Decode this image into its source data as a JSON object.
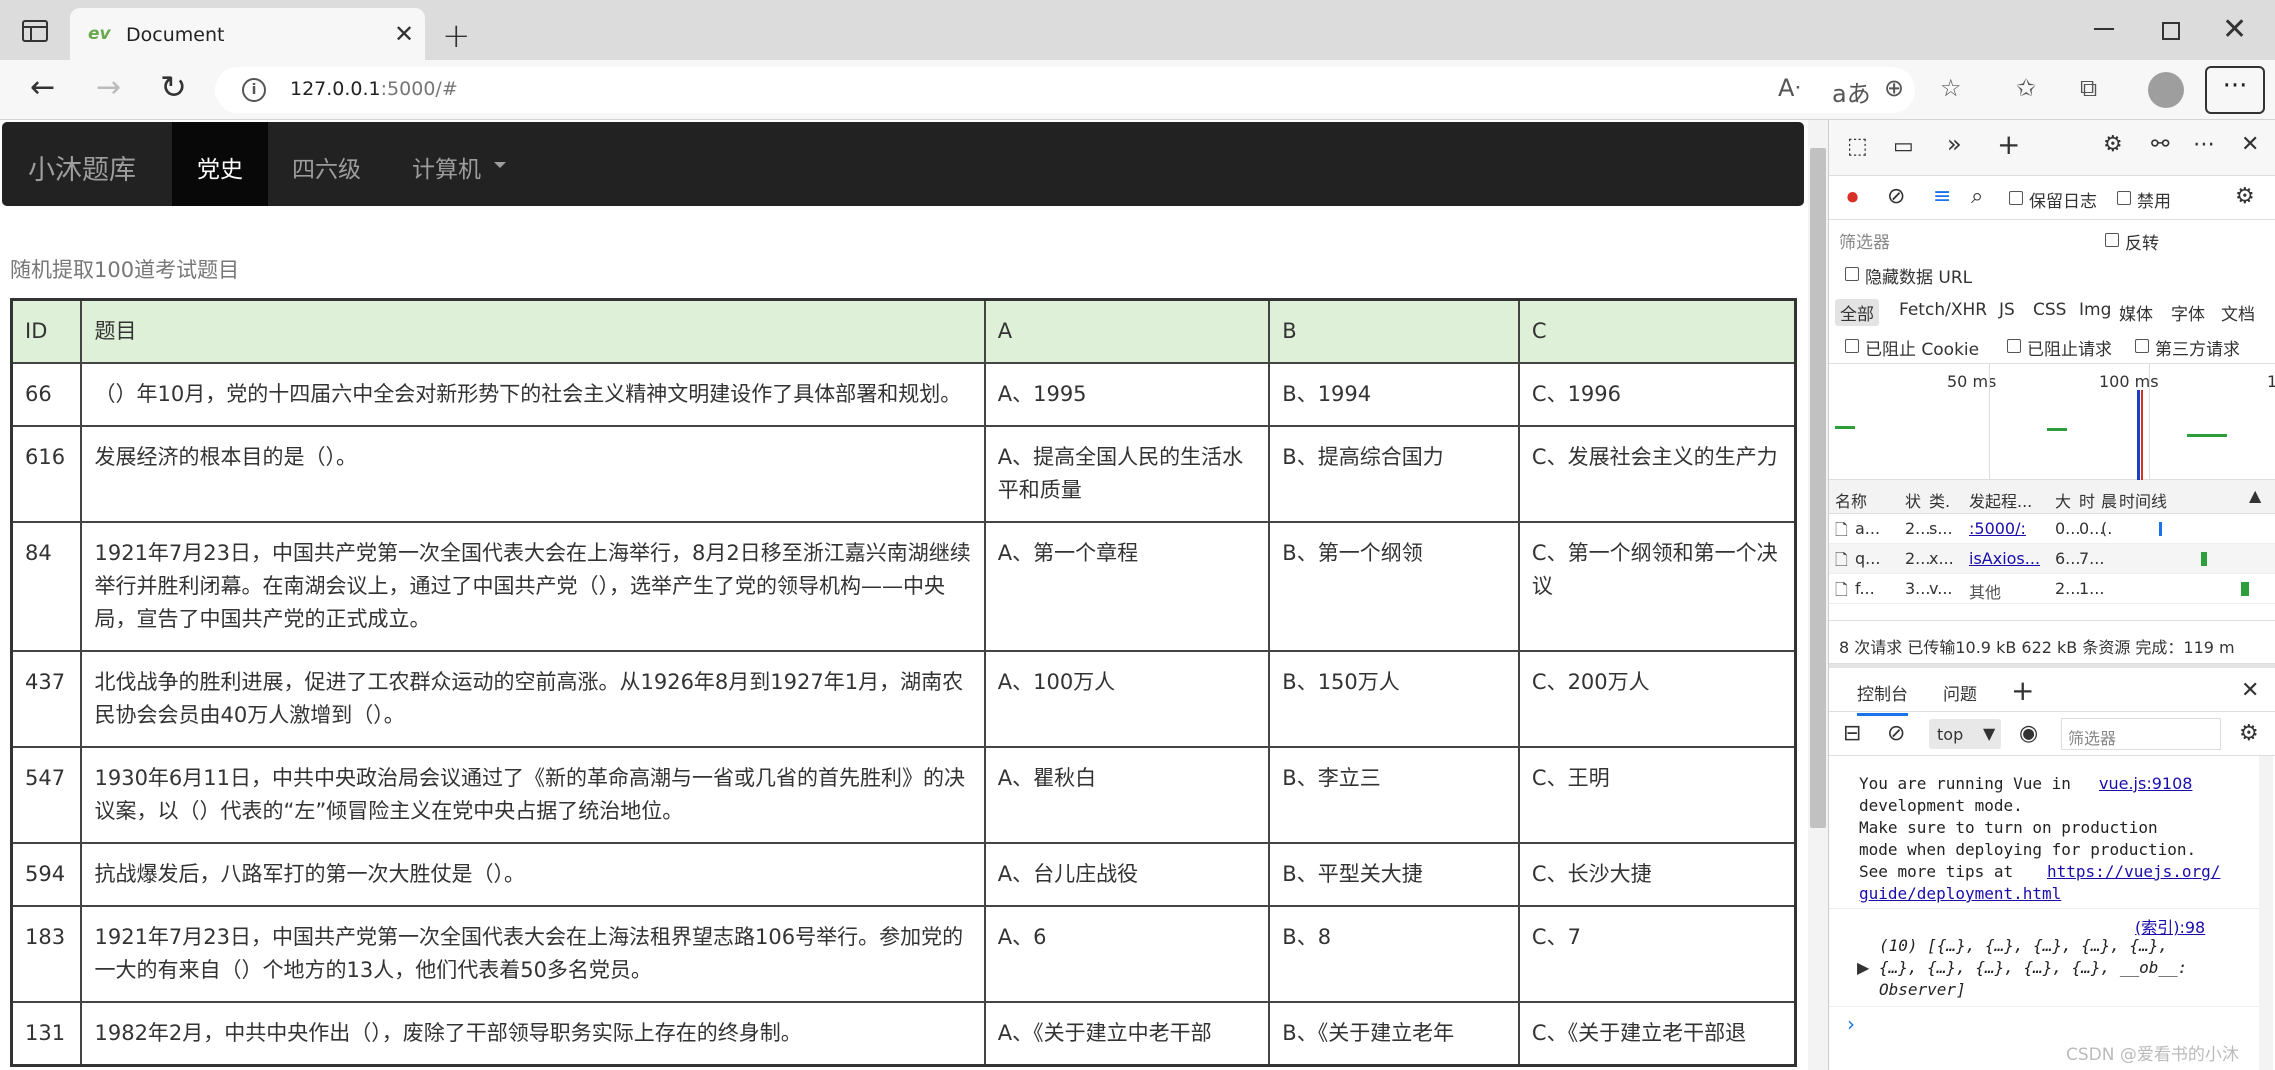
{
  "browser": {
    "tab_title": "Document",
    "tab_favicon": "ev",
    "new_tab_glyph": "+",
    "close_glyph": "✕",
    "url_host": "127.0.0.1",
    "url_rest": ":5000/#"
  },
  "site": {
    "brand": "小沐题库",
    "nav": [
      "党史",
      "四六级",
      "计算机"
    ],
    "intro": "随机提取100道考试题目"
  },
  "table": {
    "headers": [
      "ID",
      "题目",
      "A",
      "B",
      "C"
    ],
    "rows": [
      {
        "id": "66",
        "q": "（）年10月，党的十四届六中全会对新形势下的社会主义精神文明建设作了具体部署和规划。",
        "a": "A、1995",
        "b": "B、1994",
        "c": "C、1996"
      },
      {
        "id": "616",
        "q": "发展经济的根本目的是（）。",
        "a": "A、提高全国人民的生活水平和质量",
        "b": "B、提高综合国力",
        "c": "C、发展社会主义的生产力"
      },
      {
        "id": "84",
        "q": "1921年7月23日，中国共产党第一次全国代表大会在上海举行，8月2日移至浙江嘉兴南湖继续举行并胜利闭幕。在南湖会议上，通过了中国共产党（），选举产生了党的领导机构——中央局，宣告了中国共产党的正式成立。",
        "a": "A、第一个章程",
        "b": "B、第一个纲领",
        "c": "C、第一个纲领和第一个决议"
      },
      {
        "id": "437",
        "q": "北伐战争的胜利进展，促进了工农群众运动的空前高涨。从1926年8月到1927年1月，湖南农民协会会员由40万人激增到（）。",
        "a": "A、100万人",
        "b": "B、150万人",
        "c": "C、200万人"
      },
      {
        "id": "547",
        "q": "1930年6月11日，中共中央政治局会议通过了《新的革命高潮与一省或几省的首先胜利》的决议案，以（）代表的“左”倾冒险主义在党中央占据了统治地位。",
        "a": "A、瞿秋白",
        "b": "B、李立三",
        "c": "C、王明"
      },
      {
        "id": "594",
        "q": "抗战爆发后，八路军打的第一次大胜仗是（）。",
        "a": "A、台儿庄战役",
        "b": "B、平型关大捷",
        "c": "C、长沙大捷"
      },
      {
        "id": "183",
        "q": "1921年7月23日，中国共产党第一次全国代表大会在上海法租界望志路106号举行。参加党的一大的有来自（）个地方的13人，他们代表着50多名党员。",
        "a": "A、6",
        "b": "B、8",
        "c": "C、7"
      },
      {
        "id": "131",
        "q": "1982年2月，中共中央作出（），废除了干部领导职务实际上存在的终身制。",
        "a": "A、《关于建立中老干部",
        "b": "B、《关于建立老年",
        "c": "C、《关于建立老干部退"
      }
    ]
  },
  "devtools": {
    "preserve_log": "保留日志",
    "disable_cache": "禁用",
    "filter_placeholder": "筛选器",
    "invert": "反转",
    "hide_data_url": "隐藏数据 URL",
    "type_filters": [
      "全部",
      "Fetch/XHR",
      "JS",
      "CSS",
      "Img",
      "媒体",
      "字体",
      "文档"
    ],
    "blocked_cookies": "已阻止 Cookie",
    "blocked_requests": "已阻止请求",
    "third_party": "第三方请求",
    "timeline_ticks": [
      "50 ms",
      "100 ms",
      "1"
    ],
    "columns": [
      "名称",
      "状",
      "类.",
      "发起程...",
      "大",
      "时",
      "晨",
      "时间线"
    ],
    "requests": [
      {
        "name": "a...",
        "status": "2...",
        "type": "s...",
        "initiator": ":5000/:",
        "size": "0...",
        "time": "0...",
        "p": "(."
      },
      {
        "name": "q...",
        "status": "2...",
        "type": "x...",
        "initiator": "isAxios...",
        "size": "6...",
        "time": "7..."
      },
      {
        "name": "f...",
        "status": "3...",
        "type": "v...",
        "initiator": "其他",
        "size": "2...",
        "time": "1..."
      }
    ],
    "summary": "8 次请求  已传输10.9 kB  622 kB 条资源  完成：119 m",
    "console_tabs": [
      "控制台",
      "问题"
    ],
    "context": "top",
    "console_filter": "筛选器",
    "console_lines": [
      "You are running Vue in",
      "development mode.",
      "Make sure to turn on production",
      "mode when deploying for production.",
      "See more tips at"
    ],
    "vue_link": "vue.js:9108",
    "tips_link_1": "https://vuejs.org/",
    "tips_link_2": "guide/deployment.html",
    "index_link": "(索引):98",
    "array_line_1": "(10) [{…}, {…}, {…}, {…}, {…},",
    "array_line_2": "{…}, {…}, {…}, {…}, {…}, __ob__:",
    "array_line_3": "Observer]",
    "prompt": "›"
  },
  "watermark": "CSDN @爱看书的小沐"
}
